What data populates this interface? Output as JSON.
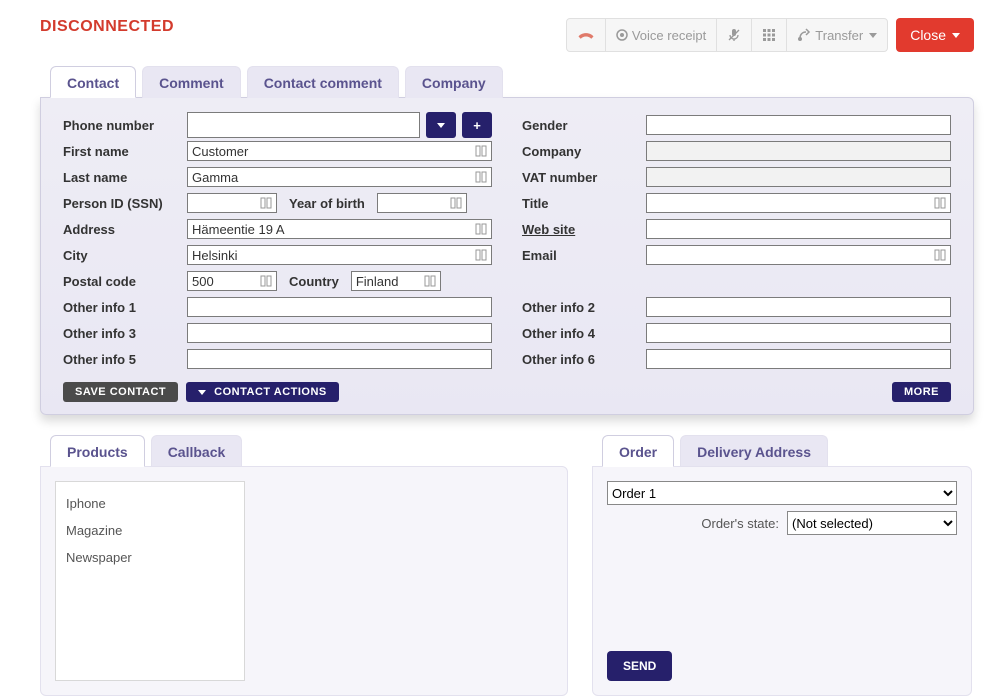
{
  "status": "DISCONNECTED",
  "toolbar": {
    "voice_receipt": "Voice receipt",
    "transfer": "Transfer",
    "close": "Close"
  },
  "contact_tabs": {
    "contact": "Contact",
    "comment": "Comment",
    "contact_comment": "Contact comment",
    "company": "Company"
  },
  "form": {
    "labels": {
      "phone_number": "Phone number",
      "first_name": "First name",
      "last_name": "Last name",
      "person_id": "Person ID (SSN)",
      "year_of_birth": "Year of birth",
      "address": "Address",
      "city": "City",
      "postal_code": "Postal code",
      "country": "Country",
      "other1": "Other info 1",
      "other3": "Other info 3",
      "other5": "Other info 5",
      "gender": "Gender",
      "company": "Company",
      "vat": "VAT number",
      "title": "Title",
      "website": "Web site",
      "email": "Email",
      "other2": "Other info 2",
      "other4": "Other info 4",
      "other6": "Other info 6"
    },
    "values": {
      "phone_number": "",
      "first_name": "Customer",
      "last_name": "Gamma",
      "person_id": "",
      "year_of_birth": "",
      "address": "Hämeentie 19 A",
      "city": "Helsinki",
      "postal_code": "500",
      "country": "Finland",
      "other1": "",
      "other3": "",
      "other5": "",
      "gender": "",
      "company": "",
      "vat": "",
      "title": "",
      "website": "",
      "email": "",
      "other2": "",
      "other4": "",
      "other6": ""
    }
  },
  "buttons": {
    "save_contact": "SAVE CONTACT",
    "contact_actions": "CONTACT ACTIONS",
    "more": "MORE",
    "send": "SEND"
  },
  "products_tabs": {
    "products": "Products",
    "callback": "Callback"
  },
  "products": {
    "items": [
      "Iphone",
      "Magazine",
      "Newspaper"
    ]
  },
  "order_tabs": {
    "order": "Order",
    "delivery": "Delivery Address"
  },
  "order": {
    "selected": "Order 1",
    "state_label": "Order's state:",
    "state_value": "(Not selected)"
  }
}
